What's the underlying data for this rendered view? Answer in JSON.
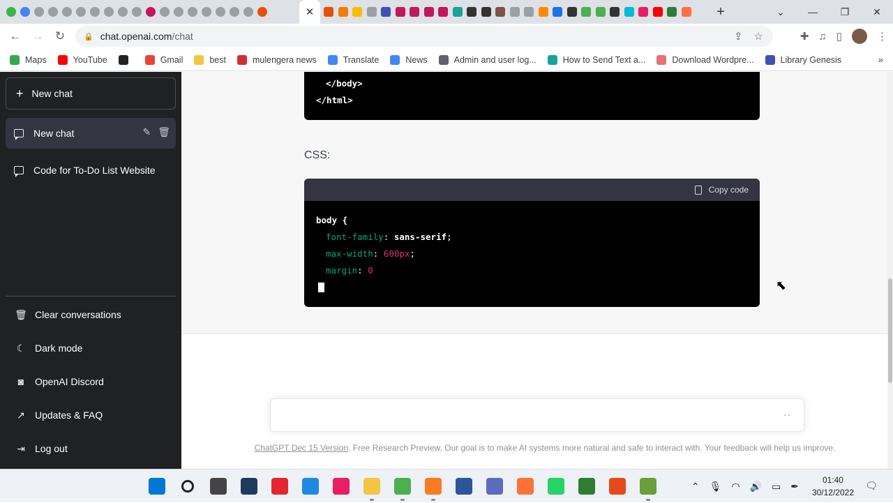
{
  "browser": {
    "url_host": "chat.openai.com",
    "url_path": "/chat",
    "active_tab_close": "✕",
    "new_tab": "+"
  },
  "bookmarks": [
    {
      "label": "Maps",
      "icon": "maps-icon",
      "color": "#34a853"
    },
    {
      "label": "YouTube",
      "icon": "youtube-icon",
      "color": "#ff0000"
    },
    {
      "label": "",
      "icon": "bird-icon",
      "color": "#222222"
    },
    {
      "label": "Gmail",
      "icon": "gmail-icon",
      "color": "#ea4335"
    },
    {
      "label": "best",
      "icon": "folder-icon",
      "color": "#f4c542"
    },
    {
      "label": "mulengera news",
      "icon": "news-site-icon",
      "color": "#d32f2f"
    },
    {
      "label": "Translate",
      "icon": "translate-icon",
      "color": "#4285f4"
    },
    {
      "label": "News",
      "icon": "google-news-icon",
      "color": "#4285f4"
    },
    {
      "label": "Admin and user log...",
      "icon": "globe-icon",
      "color": "#5f6368"
    },
    {
      "label": "How to Send Text a...",
      "icon": "hexagon-icon",
      "color": "#1aa39a"
    },
    {
      "label": "Download Wordpre...",
      "icon": "download-site-icon",
      "color": "#e57373"
    },
    {
      "label": "Library Genesis",
      "icon": "library-icon",
      "color": "#3f51b5"
    }
  ],
  "bookmarks_more": "»",
  "sidebar": {
    "new_chat_button": "New chat",
    "conversations": [
      {
        "title": "New chat",
        "active": true
      },
      {
        "title": "Code for To-Do List Website",
        "active": false
      }
    ],
    "menu": [
      {
        "label": "Clear conversations",
        "icon": "trash-icon"
      },
      {
        "label": "Dark mode",
        "icon": "moon-icon"
      },
      {
        "label": "OpenAI Discord",
        "icon": "discord-icon"
      },
      {
        "label": "Updates & FAQ",
        "icon": "external-link-icon"
      },
      {
        "label": "Log out",
        "icon": "logout-icon"
      }
    ]
  },
  "chat": {
    "prev_code": {
      "line1": "</body>",
      "line2": "</html>"
    },
    "css_label": "CSS:",
    "copy_code": "Copy code",
    "css_code": {
      "selector": "body {",
      "lines": [
        {
          "prop": "font-family",
          "value": "sans-serif",
          "value_style": "white"
        },
        {
          "prop": "max-width",
          "value": "600px",
          "value_style": "red"
        },
        {
          "prop": "margin",
          "value": "0",
          "value_style": "red",
          "no_semicolon": true
        }
      ]
    },
    "input_placeholder": "",
    "input_dots": "··",
    "footer_link": "ChatGPT Dec 15 Version",
    "footer_text": ". Free Research Preview. Our goal is to make AI systems more natural and safe to interact with. Your feedback will help us improve."
  },
  "taskbar": {
    "time": "01:40",
    "date": "30/12/2022"
  },
  "colors": {
    "sidebar_bg": "#202123",
    "code_bg": "#000000",
    "code_prop": "#00a67d",
    "code_number": "#df3079"
  }
}
